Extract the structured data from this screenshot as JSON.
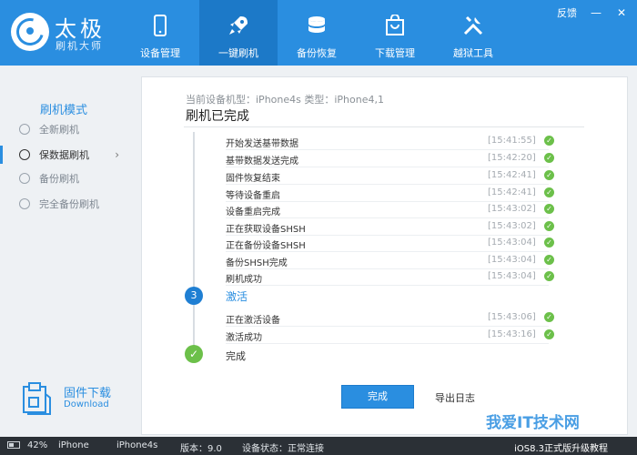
{
  "brand": {
    "title": "太极",
    "subtitle": "刷机大师"
  },
  "nav": [
    {
      "label": "设备管理",
      "icon": "phone-icon"
    },
    {
      "label": "一键刷机",
      "icon": "rocket-icon",
      "active": true
    },
    {
      "label": "备份恢复",
      "icon": "database-icon"
    },
    {
      "label": "下载管理",
      "icon": "bag-icon"
    },
    {
      "label": "越狱工具",
      "icon": "tools-icon"
    }
  ],
  "window": {
    "feedback": "反馈",
    "min": "—",
    "close": "✕"
  },
  "sidebar": {
    "title": "刷机模式",
    "items": [
      {
        "label": "全新刷机"
      },
      {
        "label": "保数据刷机",
        "active": true
      },
      {
        "label": "备份刷机"
      },
      {
        "label": "完全备份刷机"
      }
    ],
    "firmware_download": {
      "label": "固件下载",
      "sublabel": "Download"
    }
  },
  "main": {
    "device_line": "当前设备机型：iPhone4s 类型：iPhone4,1",
    "status": "刷机已完成",
    "logs": [
      {
        "text": "开始发送基带数据",
        "time": "[15:41:55]"
      },
      {
        "text": "基带数据发送完成",
        "time": "[15:42:20]"
      },
      {
        "text": "固件恢复结束",
        "time": "[15:42:41]"
      },
      {
        "text": "等待设备重启",
        "time": "[15:42:41]"
      },
      {
        "text": "设备重启完成",
        "time": "[15:43:02]"
      },
      {
        "text": "正在获取设备SHSH",
        "time": "[15:43:02]"
      },
      {
        "text": "正在备份设备SHSH",
        "time": "[15:43:04]"
      },
      {
        "text": "备份SHSH完成",
        "time": "[15:43:04]"
      },
      {
        "text": "刷机成功",
        "time": "[15:43:04]"
      }
    ],
    "step3": {
      "number": "3",
      "title": "激活"
    },
    "activation_logs": [
      {
        "text": "正在激活设备",
        "time": "[15:43:06]"
      },
      {
        "text": "激活成功",
        "time": "[15:43:16]"
      }
    ],
    "complete": {
      "title": "完成"
    },
    "done_button": "完成",
    "export_log": "导出日志"
  },
  "statusbar": {
    "battery": "42%",
    "device_type": "iPhone",
    "model": "iPhone4s",
    "version": "版本：9.0",
    "device_status": "设备状态：正常连接",
    "promo": "iOS8.3正式版升级教程"
  },
  "watermark": "我爱IT技术网"
}
